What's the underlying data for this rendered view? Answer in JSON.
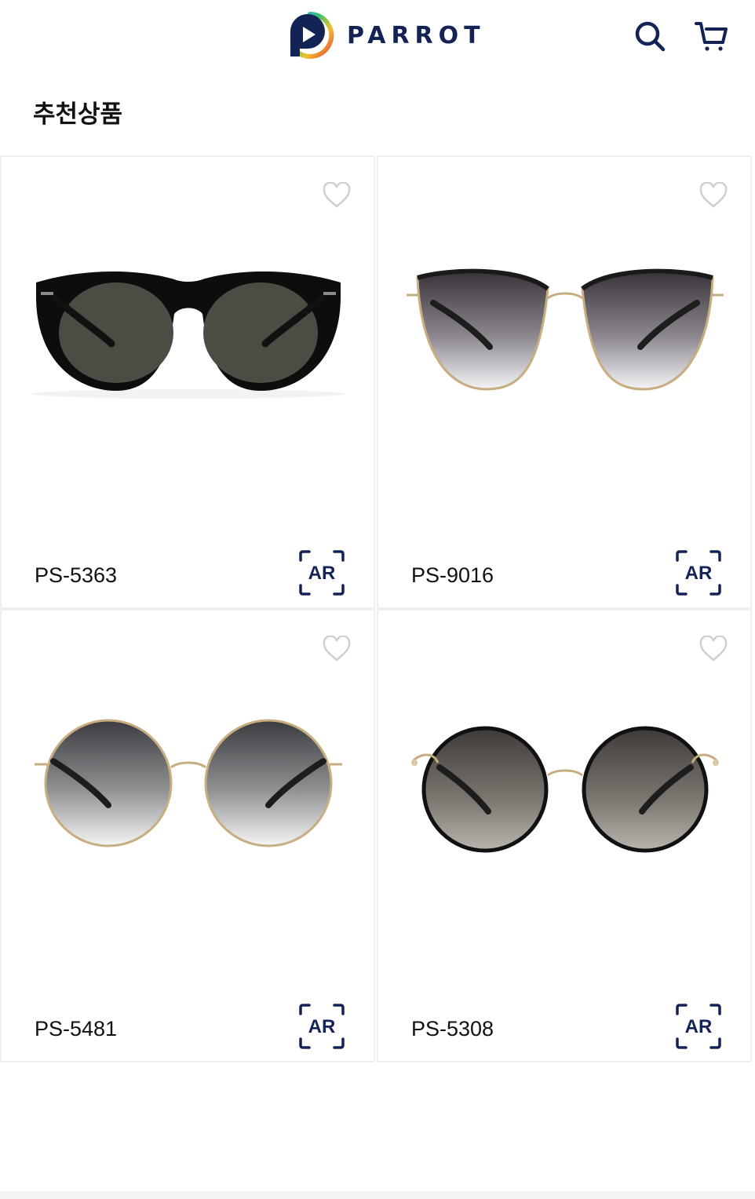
{
  "header": {
    "brand": "PARROT",
    "icons": {
      "search": "search-icon",
      "cart": "cart-icon"
    }
  },
  "section": {
    "title": "추천상품"
  },
  "products": [
    {
      "code": "PS-5363",
      "ar_label": "AR",
      "style": "black-round"
    },
    {
      "code": "PS-9016",
      "ar_label": "AR",
      "style": "gold-cateye-gradient"
    },
    {
      "code": "PS-5481",
      "ar_label": "AR",
      "style": "gold-round-gradient"
    },
    {
      "code": "PS-5308",
      "ar_label": "AR",
      "style": "black-gold-round"
    }
  ],
  "colors": {
    "brand_navy": "#132356",
    "heart_outline": "#cfcfcf",
    "card_border": "#efefef"
  }
}
